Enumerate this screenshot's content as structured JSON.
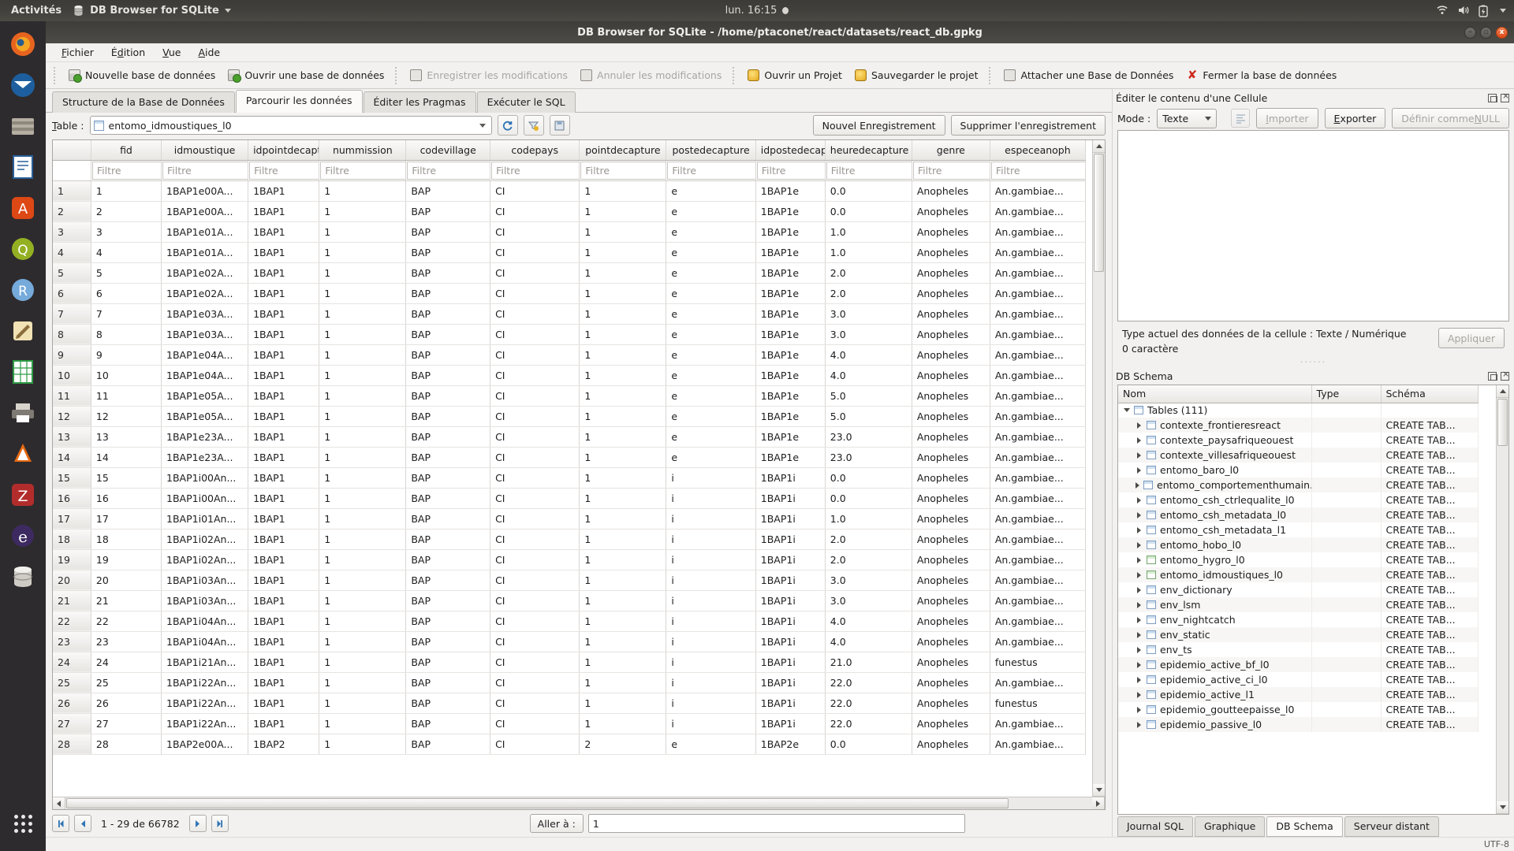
{
  "desktop": {
    "activities": "Activités",
    "app_menu": "DB Browser for SQLite",
    "clock": "lun. 16:15",
    "tray": {
      "wifi": "wifi-icon",
      "volume": "volume-icon",
      "battery": "battery-icon"
    },
    "launcher": [
      {
        "name": "firefox",
        "glyph": "🦊"
      },
      {
        "name": "thunderbird",
        "glyph": "✉"
      },
      {
        "name": "files",
        "glyph": "🗄"
      },
      {
        "name": "libreoffice-writer",
        "glyph": "📄"
      },
      {
        "name": "ubuntu-software",
        "glyph": "A"
      },
      {
        "name": "qgis",
        "glyph": "Q"
      },
      {
        "name": "rstudio",
        "glyph": "R"
      },
      {
        "name": "text-editor",
        "glyph": "✎"
      },
      {
        "name": "libreoffice-calc",
        "glyph": "▦"
      },
      {
        "name": "printers",
        "glyph": "🖨"
      },
      {
        "name": "vlc",
        "glyph": "▲"
      },
      {
        "name": "zotero",
        "glyph": "Z"
      },
      {
        "name": "eclipse",
        "glyph": "e"
      },
      {
        "name": "db-browser-sqlite",
        "glyph": "🛢"
      }
    ]
  },
  "window": {
    "title": "DB Browser for SQLite - /home/ptaconet/react/datasets/react_db.gpkg",
    "buttons": {
      "minimize": "–",
      "maximize": "▫",
      "close": "x"
    }
  },
  "menubar": [
    "Fichier",
    "Édition",
    "Vue",
    "Aide"
  ],
  "toolbar": [
    {
      "label": "Nouvelle base de données",
      "icon": "new-database-icon",
      "disabled": false
    },
    {
      "label": "Ouvrir une base de données",
      "icon": "open-database-icon",
      "disabled": false
    },
    {
      "label": "Enregistrer les modifications",
      "icon": "save-changes-icon",
      "disabled": true
    },
    {
      "label": "Annuler les modifications",
      "icon": "revert-changes-icon",
      "disabled": true
    },
    {
      "label": "Ouvrir un Projet",
      "icon": "open-project-icon",
      "disabled": false
    },
    {
      "label": "Sauvegarder le projet",
      "icon": "save-project-icon",
      "disabled": false
    },
    {
      "label": "Attacher une Base de Données",
      "icon": "attach-database-icon",
      "disabled": false
    },
    {
      "label": "Fermer la base de données",
      "icon": "close-database-icon",
      "disabled": false
    }
  ],
  "tabs": [
    {
      "label": "Structure de la Base de Données",
      "active": false
    },
    {
      "label": "Parcourir les données",
      "active": true
    },
    {
      "label": "Éditer les Pragmas",
      "active": false
    },
    {
      "label": "Exécuter le SQL",
      "active": false
    }
  ],
  "browse": {
    "table_label": "Table :",
    "table_value": "entomo_idmoustiques_l0",
    "tool_icons": [
      "refresh-icon",
      "clear-filters-icon",
      "save-view-icon"
    ],
    "new_record_label": "Nouvel Enregistrement",
    "delete_record_label": "Supprimer l'enregistrement",
    "filter_placeholder": "Filtre",
    "columns": [
      "fid",
      "idmoustique",
      "idpointdecapture",
      "nummission",
      "codevillage",
      "codepays",
      "pointdecapture",
      "postedecapture",
      "idpostedecapture",
      "heuredecapture",
      "genre",
      "especeanoph"
    ],
    "rows": [
      {
        "n": "1",
        "cells": [
          "1",
          "1BAP1e00A...",
          "1BAP1",
          "1",
          "BAP",
          "CI",
          "1",
          "e",
          "1BAP1e",
          "0.0",
          "Anopheles",
          "An.gambiae..."
        ]
      },
      {
        "n": "2",
        "cells": [
          "2",
          "1BAP1e00A...",
          "1BAP1",
          "1",
          "BAP",
          "CI",
          "1",
          "e",
          "1BAP1e",
          "0.0",
          "Anopheles",
          "An.gambiae..."
        ]
      },
      {
        "n": "3",
        "cells": [
          "3",
          "1BAP1e01A...",
          "1BAP1",
          "1",
          "BAP",
          "CI",
          "1",
          "e",
          "1BAP1e",
          "1.0",
          "Anopheles",
          "An.gambiae..."
        ]
      },
      {
        "n": "4",
        "cells": [
          "4",
          "1BAP1e01A...",
          "1BAP1",
          "1",
          "BAP",
          "CI",
          "1",
          "e",
          "1BAP1e",
          "1.0",
          "Anopheles",
          "An.gambiae..."
        ]
      },
      {
        "n": "5",
        "cells": [
          "5",
          "1BAP1e02A...",
          "1BAP1",
          "1",
          "BAP",
          "CI",
          "1",
          "e",
          "1BAP1e",
          "2.0",
          "Anopheles",
          "An.gambiae..."
        ]
      },
      {
        "n": "6",
        "cells": [
          "6",
          "1BAP1e02A...",
          "1BAP1",
          "1",
          "BAP",
          "CI",
          "1",
          "e",
          "1BAP1e",
          "2.0",
          "Anopheles",
          "An.gambiae..."
        ]
      },
      {
        "n": "7",
        "cells": [
          "7",
          "1BAP1e03A...",
          "1BAP1",
          "1",
          "BAP",
          "CI",
          "1",
          "e",
          "1BAP1e",
          "3.0",
          "Anopheles",
          "An.gambiae..."
        ]
      },
      {
        "n": "8",
        "cells": [
          "8",
          "1BAP1e03A...",
          "1BAP1",
          "1",
          "BAP",
          "CI",
          "1",
          "e",
          "1BAP1e",
          "3.0",
          "Anopheles",
          "An.gambiae..."
        ]
      },
      {
        "n": "9",
        "cells": [
          "9",
          "1BAP1e04A...",
          "1BAP1",
          "1",
          "BAP",
          "CI",
          "1",
          "e",
          "1BAP1e",
          "4.0",
          "Anopheles",
          "An.gambiae..."
        ]
      },
      {
        "n": "10",
        "cells": [
          "10",
          "1BAP1e04A...",
          "1BAP1",
          "1",
          "BAP",
          "CI",
          "1",
          "e",
          "1BAP1e",
          "4.0",
          "Anopheles",
          "An.gambiae..."
        ]
      },
      {
        "n": "11",
        "cells": [
          "11",
          "1BAP1e05A...",
          "1BAP1",
          "1",
          "BAP",
          "CI",
          "1",
          "e",
          "1BAP1e",
          "5.0",
          "Anopheles",
          "An.gambiae..."
        ]
      },
      {
        "n": "12",
        "cells": [
          "12",
          "1BAP1e05A...",
          "1BAP1",
          "1",
          "BAP",
          "CI",
          "1",
          "e",
          "1BAP1e",
          "5.0",
          "Anopheles",
          "An.gambiae..."
        ]
      },
      {
        "n": "13",
        "cells": [
          "13",
          "1BAP1e23A...",
          "1BAP1",
          "1",
          "BAP",
          "CI",
          "1",
          "e",
          "1BAP1e",
          "23.0",
          "Anopheles",
          "An.gambiae..."
        ]
      },
      {
        "n": "14",
        "cells": [
          "14",
          "1BAP1e23A...",
          "1BAP1",
          "1",
          "BAP",
          "CI",
          "1",
          "e",
          "1BAP1e",
          "23.0",
          "Anopheles",
          "An.gambiae..."
        ]
      },
      {
        "n": "15",
        "cells": [
          "15",
          "1BAP1i00An...",
          "1BAP1",
          "1",
          "BAP",
          "CI",
          "1",
          "i",
          "1BAP1i",
          "0.0",
          "Anopheles",
          "An.gambiae..."
        ]
      },
      {
        "n": "16",
        "cells": [
          "16",
          "1BAP1i00An...",
          "1BAP1",
          "1",
          "BAP",
          "CI",
          "1",
          "i",
          "1BAP1i",
          "0.0",
          "Anopheles",
          "An.gambiae..."
        ]
      },
      {
        "n": "17",
        "cells": [
          "17",
          "1BAP1i01An...",
          "1BAP1",
          "1",
          "BAP",
          "CI",
          "1",
          "i",
          "1BAP1i",
          "1.0",
          "Anopheles",
          "An.gambiae..."
        ]
      },
      {
        "n": "18",
        "cells": [
          "18",
          "1BAP1i02An...",
          "1BAP1",
          "1",
          "BAP",
          "CI",
          "1",
          "i",
          "1BAP1i",
          "2.0",
          "Anopheles",
          "An.gambiae..."
        ]
      },
      {
        "n": "19",
        "cells": [
          "19",
          "1BAP1i02An...",
          "1BAP1",
          "1",
          "BAP",
          "CI",
          "1",
          "i",
          "1BAP1i",
          "2.0",
          "Anopheles",
          "An.gambiae..."
        ]
      },
      {
        "n": "20",
        "cells": [
          "20",
          "1BAP1i03An...",
          "1BAP1",
          "1",
          "BAP",
          "CI",
          "1",
          "i",
          "1BAP1i",
          "3.0",
          "Anopheles",
          "An.gambiae..."
        ]
      },
      {
        "n": "21",
        "cells": [
          "21",
          "1BAP1i03An...",
          "1BAP1",
          "1",
          "BAP",
          "CI",
          "1",
          "i",
          "1BAP1i",
          "3.0",
          "Anopheles",
          "An.gambiae..."
        ]
      },
      {
        "n": "22",
        "cells": [
          "22",
          "1BAP1i04An...",
          "1BAP1",
          "1",
          "BAP",
          "CI",
          "1",
          "i",
          "1BAP1i",
          "4.0",
          "Anopheles",
          "An.gambiae..."
        ]
      },
      {
        "n": "23",
        "cells": [
          "23",
          "1BAP1i04An...",
          "1BAP1",
          "1",
          "BAP",
          "CI",
          "1",
          "i",
          "1BAP1i",
          "4.0",
          "Anopheles",
          "An.gambiae..."
        ]
      },
      {
        "n": "24",
        "cells": [
          "24",
          "1BAP1i21An...",
          "1BAP1",
          "1",
          "BAP",
          "CI",
          "1",
          "i",
          "1BAP1i",
          "21.0",
          "Anopheles",
          "funestus"
        ]
      },
      {
        "n": "25",
        "cells": [
          "25",
          "1BAP1i22An...",
          "1BAP1",
          "1",
          "BAP",
          "CI",
          "1",
          "i",
          "1BAP1i",
          "22.0",
          "Anopheles",
          "An.gambiae..."
        ]
      },
      {
        "n": "26",
        "cells": [
          "26",
          "1BAP1i22An...",
          "1BAP1",
          "1",
          "BAP",
          "CI",
          "1",
          "i",
          "1BAP1i",
          "22.0",
          "Anopheles",
          "funestus"
        ]
      },
      {
        "n": "27",
        "cells": [
          "27",
          "1BAP1i22An...",
          "1BAP1",
          "1",
          "BAP",
          "CI",
          "1",
          "i",
          "1BAP1i",
          "22.0",
          "Anopheles",
          "An.gambiae..."
        ]
      },
      {
        "n": "28",
        "cells": [
          "28",
          "1BAP2e00A...",
          "1BAP2",
          "1",
          "BAP",
          "CI",
          "2",
          "e",
          "1BAP2e",
          "0.0",
          "Anopheles",
          "An.gambiae..."
        ]
      }
    ]
  },
  "pager": {
    "first": "first-page-icon",
    "prev": "previous-page-icon",
    "range": "1 - 29 de 66782",
    "next": "next-page-icon",
    "last": "last-page-icon",
    "goto_label": "Aller à :",
    "goto_value": "1"
  },
  "cell_editor": {
    "panel_title": "Éditer le contenu d'une Cellule",
    "mode_label": "Mode :",
    "mode_value": "Texte",
    "word_wrap_icon": "word-wrap-icon",
    "import_label": "Importer",
    "export_label": "Exporter",
    "set_null_label": "Définir comme NULL",
    "content": "",
    "type_info": "Type actuel des données de la cellule : Texte / Numérique",
    "char_count": "0 caractère",
    "apply_label": "Appliquer"
  },
  "db_schema": {
    "panel_title": "DB Schema",
    "headers": [
      "Nom",
      "Type",
      "Schéma"
    ],
    "root": {
      "label": "Tables (111)",
      "expanded": true
    },
    "create_text": "CREATE TAB...",
    "items": [
      {
        "label": "contexte_frontieresreact",
        "green": false
      },
      {
        "label": "contexte_paysafriqueouest",
        "green": false
      },
      {
        "label": "contexte_villesafriqueouest",
        "green": false
      },
      {
        "label": "entomo_baro_l0",
        "green": false
      },
      {
        "label": "entomo_comportementhumain...",
        "green": false
      },
      {
        "label": "entomo_csh_ctrlequalite_l0",
        "green": false
      },
      {
        "label": "entomo_csh_metadata_l0",
        "green": false
      },
      {
        "label": "entomo_csh_metadata_l1",
        "green": false
      },
      {
        "label": "entomo_hobo_l0",
        "green": false
      },
      {
        "label": "entomo_hygro_l0",
        "green": true
      },
      {
        "label": "entomo_idmoustiques_l0",
        "green": true
      },
      {
        "label": "env_dictionary",
        "green": false
      },
      {
        "label": "env_lsm",
        "green": false
      },
      {
        "label": "env_nightcatch",
        "green": false
      },
      {
        "label": "env_static",
        "green": false
      },
      {
        "label": "env_ts",
        "green": false
      },
      {
        "label": "epidemio_active_bf_l0",
        "green": false
      },
      {
        "label": "epidemio_active_ci_l0",
        "green": false
      },
      {
        "label": "epidemio_active_l1",
        "green": false
      },
      {
        "label": "epidemio_goutteepaisse_l0",
        "green": false
      },
      {
        "label": "epidemio_passive_l0",
        "green": false
      }
    ]
  },
  "bottom_tabs": [
    {
      "label": "Journal SQL",
      "active": false
    },
    {
      "label": "Graphique",
      "active": false
    },
    {
      "label": "DB Schema",
      "active": true
    },
    {
      "label": "Serveur distant",
      "active": false
    }
  ],
  "statusbar": {
    "encoding": "UTF-8"
  }
}
